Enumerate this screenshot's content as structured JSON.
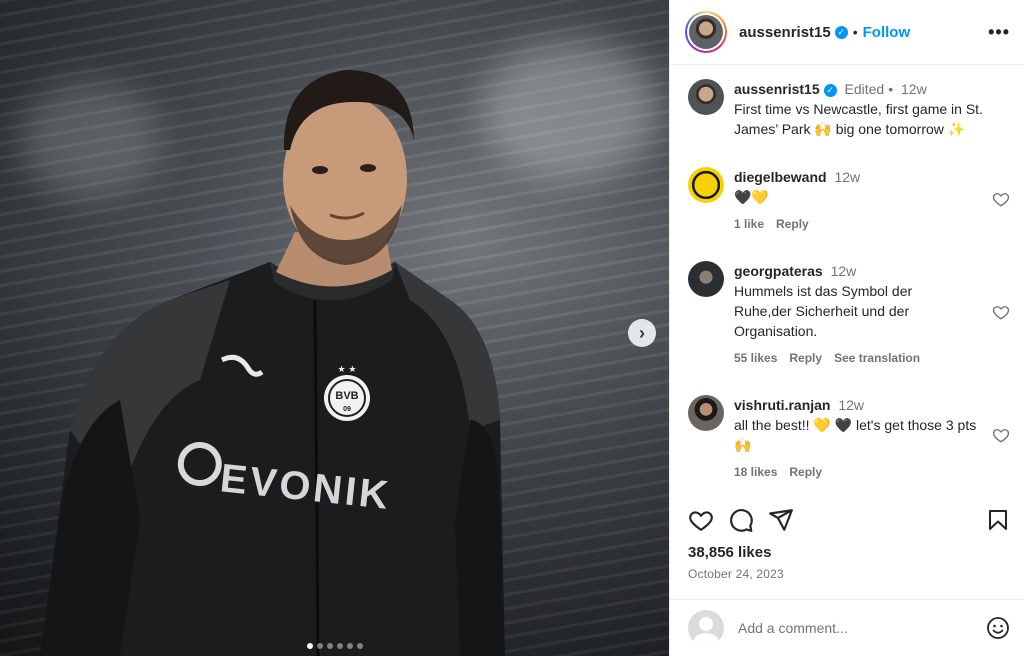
{
  "header": {
    "username": "aussenrist15",
    "follow_label": "Follow",
    "more_label": "•••"
  },
  "caption": {
    "username": "aussenrist15",
    "edited_label": "Edited",
    "time": "12w",
    "text": "First time vs Newcastle, first game in St. James’ Park 🙌 big one tomorrow ✨"
  },
  "comments": [
    {
      "username": "diegelbewand",
      "time": "12w",
      "text": "🖤💛",
      "likes": "1 like",
      "reply": "Reply"
    },
    {
      "username": "georgpateras",
      "time": "12w",
      "text": "Hummels ist das Symbol der Ruhe,der Sicherheit und der Organisation.",
      "likes": "55 likes",
      "reply": "Reply",
      "translate": "See translation"
    },
    {
      "username": "vishruti.ranjan",
      "time": "12w",
      "text": "all the best!! 💛 🖤 let's get those 3 pts 🙌",
      "likes": "18 likes",
      "reply": "Reply"
    }
  ],
  "post": {
    "likes": "38,856 likes",
    "date": "October 24, 2023"
  },
  "add_comment": {
    "placeholder": "Add a comment..."
  },
  "carousel": {
    "slides": 6,
    "active": 0,
    "next_label": "›"
  },
  "jersey": {
    "sponsor": "EVONIK",
    "badge": "BVB",
    "badge_year": "09"
  },
  "colors": {
    "accent": "#0095f6",
    "muted": "#737373",
    "text": "#262626",
    "divider": "#efefef"
  },
  "icons": [
    "heart-icon",
    "comment-icon",
    "share-icon",
    "bookmark-icon",
    "emoji-icon",
    "verified-icon",
    "more-icon",
    "chevron-right-icon"
  ]
}
